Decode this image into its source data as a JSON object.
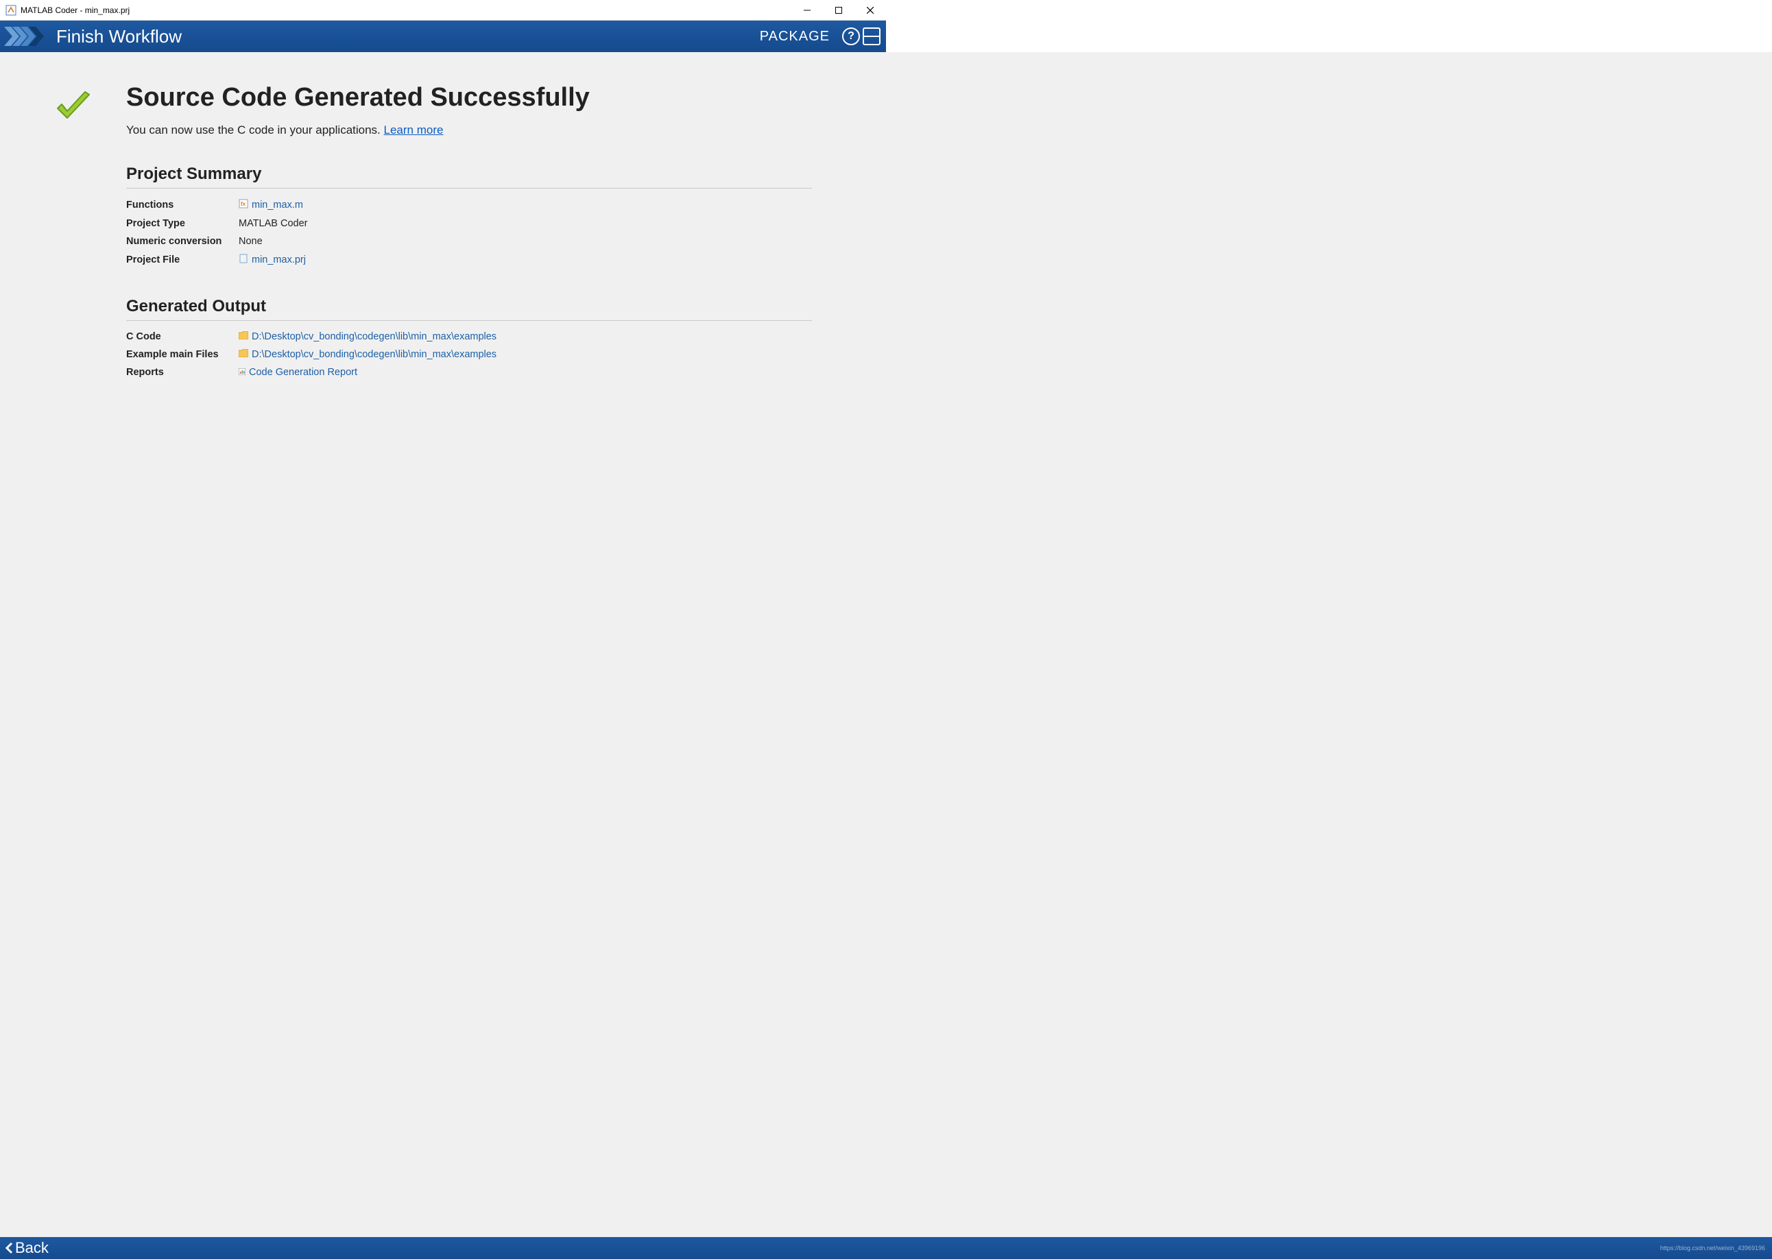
{
  "window": {
    "title": "MATLAB Coder - min_max.prj"
  },
  "ribbon": {
    "title": "Finish Workflow",
    "package": "PACKAGE"
  },
  "main": {
    "heading": "Source Code Generated Successfully",
    "subtext": "You can now use the C code in your applications. ",
    "learn_more": "Learn more"
  },
  "project_summary": {
    "heading": "Project Summary",
    "rows": {
      "functions_label": "Functions",
      "functions_value": "min_max.m",
      "project_type_label": "Project Type",
      "project_type_value": "MATLAB Coder",
      "numeric_conv_label": "Numeric conversion",
      "numeric_conv_value": "None",
      "project_file_label": "Project File",
      "project_file_value": "min_max.prj"
    }
  },
  "generated_output": {
    "heading": "Generated Output",
    "rows": {
      "ccode_label": "C Code",
      "ccode_value": "D:\\Desktop\\cv_bonding\\codegen\\lib\\min_max\\examples",
      "example_label": "Example main Files",
      "example_value": "D:\\Desktop\\cv_bonding\\codegen\\lib\\min_max\\examples",
      "reports_label": "Reports",
      "reports_value": "Code Generation Report"
    }
  },
  "footer": {
    "back": "Back",
    "watermark": "https://blog.csdn.net/weixin_43969196"
  }
}
